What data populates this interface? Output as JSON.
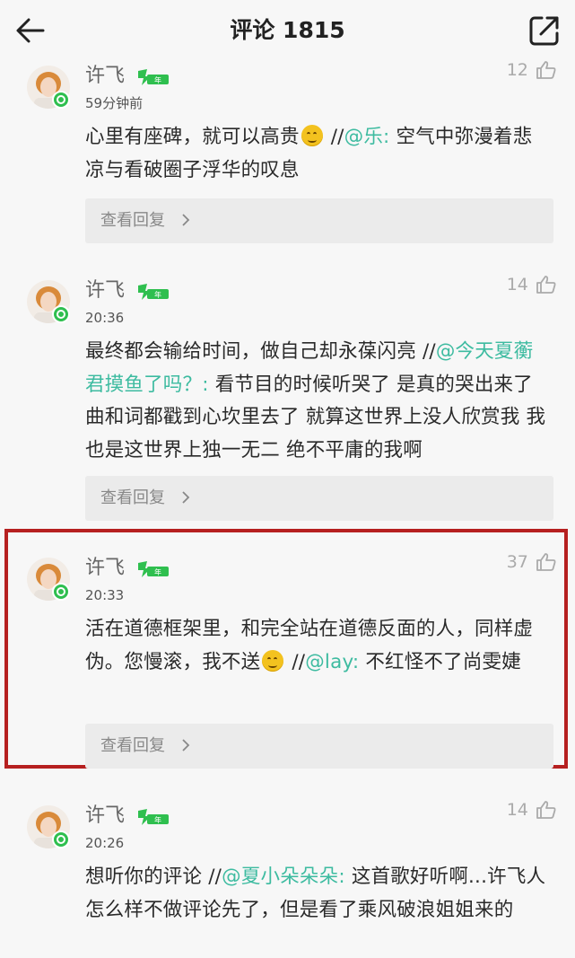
{
  "header": {
    "title": "评论 1815",
    "back_icon": "arrow-left-icon",
    "share_icon": "share-icon"
  },
  "comments": [
    {
      "username": "许飞",
      "badge": "LV5 年",
      "time": "59分钟前",
      "likes": "12",
      "text_before": "心里有座碑，就可以高贵",
      "has_emoji": true,
      "separator": " //",
      "mention": "@乐:",
      "text_after": " 空气中弥漫着悲凉与看破圈子浮华的叹息",
      "replies_label": "查看回复"
    },
    {
      "username": "许飞",
      "badge": "LV5 年",
      "time": "20:36",
      "likes": "14",
      "text_before": "最终都会输给时间，做自己却永葆闪亮",
      "separator": " //",
      "mention": "@今天夏蘅君摸鱼了吗？:",
      "text_after": " 看节目的时候听哭了 是真的哭出来了 曲和词都戳到心坎里去了 就算这世界上没人欣赏我 我也是这世界上独一无二 绝不平庸的我啊",
      "replies_label": "查看回复"
    },
    {
      "username": "许飞",
      "badge": "LV5 年",
      "time": "20:33",
      "likes": "37",
      "text_before": "活在道德框架里，和完全站在道德反面的人，同样虚伪。您慢滚，我不送",
      "has_emoji": true,
      "separator": " //",
      "mention": "@lay:",
      "text_after": " 不红怪不了尚雯婕",
      "replies_label": "查看回复"
    },
    {
      "username": "许飞",
      "badge": "LV5 年",
      "time": "20:26",
      "likes": "14",
      "text_before": "想听你的评论",
      "separator": " //",
      "mention": "@夏小朵朵朵:",
      "text_after": " 这首歌好听啊...许飞人怎么样不做评论先了，但是看了乘风破浪姐姐来的"
    }
  ],
  "colors": {
    "mention": "#3dbba0",
    "highlight_border": "#b62020",
    "badge_green": "#2fbf4f"
  }
}
